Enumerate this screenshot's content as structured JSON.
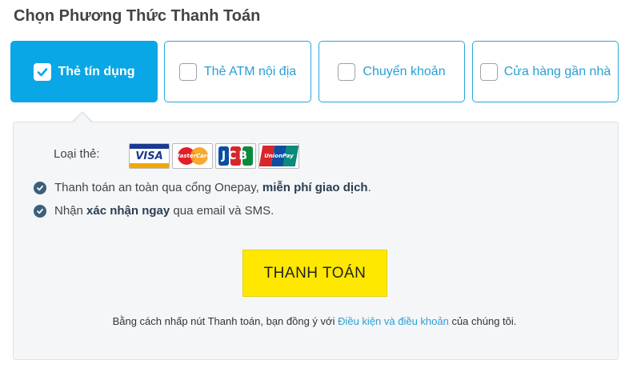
{
  "header": {
    "title": "Chọn Phương Thức Thanh Toán"
  },
  "tabs": [
    {
      "label": "Thẻ tín dụng",
      "active": true
    },
    {
      "label": "Thẻ ATM nội địa",
      "active": false
    },
    {
      "label": "Chuyển khoản",
      "active": false
    },
    {
      "label": "Cửa hàng gần nhà",
      "active": false
    }
  ],
  "panel": {
    "card_label": "Loại thẻ:",
    "card_logos": [
      {
        "name": "visa-logo",
        "text": "VISA"
      },
      {
        "name": "mastercard-logo",
        "text": "MasterCard"
      },
      {
        "name": "jcb-logo",
        "text": "JCB"
      },
      {
        "name": "unionpay-logo",
        "text": "UnionPay"
      }
    ],
    "features": [
      {
        "before": "Thanh toán an toàn qua cổng Onepay, ",
        "bold": "miễn phí giao dịch",
        "after": "."
      },
      {
        "before": "Nhận ",
        "bold": "xác nhận ngay",
        "after": " qua email và SMS."
      }
    ],
    "pay_button": "THANH TOÁN",
    "terms": {
      "before": "Bằng cách nhấp nút Thanh toán, bạn đồng ý với ",
      "link": "Điều kiện và điều khoản",
      "after": " của chúng tôi."
    }
  },
  "colors": {
    "accent": "#0aa7e6",
    "link": "#2a9fd6",
    "pay_button": "#ffe800",
    "check_icon": "#3d5f7a"
  }
}
